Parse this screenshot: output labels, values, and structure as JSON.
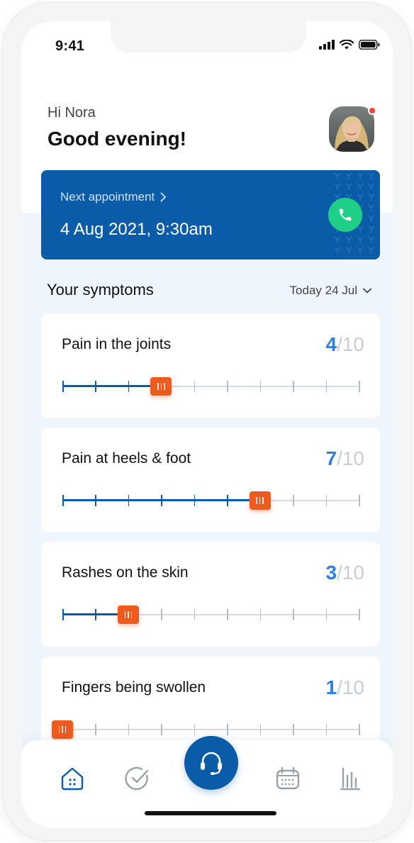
{
  "status_bar": {
    "time": "9:41"
  },
  "header": {
    "greeting": "Hi Nora",
    "title": "Good evening!",
    "has_notification": true
  },
  "appointment": {
    "label": "Next appointment",
    "date": "4 Aug 2021, 9:30am"
  },
  "symptoms_section": {
    "title": "Your symptoms",
    "date_filter": "Today 24 Jul"
  },
  "symptoms": [
    {
      "name": "Pain in the joints",
      "value": "4",
      "max": "/10",
      "level": 4
    },
    {
      "name": "Pain at heels & foot",
      "value": "7",
      "max": "/10",
      "level": 7
    },
    {
      "name": "Rashes on the skin",
      "value": "3",
      "max": "/10",
      "level": 3
    },
    {
      "name": "Fingers being swollen",
      "value": "1",
      "max": "/10",
      "level": 1
    }
  ],
  "tabbar": {
    "items": [
      {
        "icon": "home-icon",
        "active": true
      },
      {
        "icon": "check-circle-icon",
        "active": false
      },
      {
        "icon": "headset-icon",
        "active": false,
        "center": true
      },
      {
        "icon": "calendar-icon",
        "active": false
      },
      {
        "icon": "bar-chart-icon",
        "active": false
      }
    ]
  },
  "colors": {
    "brand_blue": "#0b5ca8",
    "accent_orange": "#ee5a1f",
    "call_green": "#1fcf86",
    "score_blue": "#2f7fe0",
    "light_bg": "#eef5fc"
  }
}
